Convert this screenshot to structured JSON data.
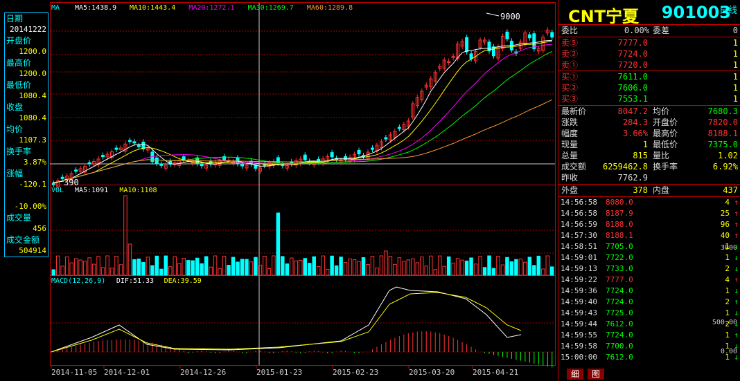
{
  "left": {
    "period": "日线",
    "fields": [
      {
        "label": "日期",
        "value": "20141222",
        "color": "#ffffff"
      },
      {
        "label": "开盘价",
        "value": "1200.0",
        "color": "#ffff00"
      },
      {
        "label": "最高价",
        "value": "1200.0",
        "color": "#ffff00"
      },
      {
        "label": "最低价",
        "value": "1080.4",
        "color": "#ffff00"
      },
      {
        "label": "收盘",
        "value": "1080.4",
        "color": "#ffff00"
      },
      {
        "label": "均价",
        "value": "1107.3",
        "color": "#ffff00"
      },
      {
        "label": "换手率",
        "value": "3.87%",
        "color": "#ffff00"
      },
      {
        "label": "涨幅",
        "value": "-120.1",
        "color": "#ffff00"
      },
      {
        "label": "",
        "value": "-10.00%",
        "color": "#ffff00"
      },
      {
        "label": "成交量",
        "value": "456",
        "color": "#ffff00"
      },
      {
        "label": "成交金额",
        "value": "504914",
        "color": "#ffff00"
      }
    ],
    "axis": {
      "vol1": "3000",
      "macd1": "500.00",
      "macd0": "0.00"
    }
  },
  "chart": {
    "ma_legend": [
      {
        "label": "MA",
        "color": "#00ffff"
      },
      {
        "label": "MA5:1438.9",
        "color": "#ffffff"
      },
      {
        "label": "MA10:1443.4",
        "color": "#ffff00"
      },
      {
        "label": "MA20:1272.1",
        "color": "#ff00ff"
      },
      {
        "label": "MA30:1269.7",
        "color": "#00ff00"
      },
      {
        "label": "MA60:1289.8",
        "color": "#ff9933"
      }
    ],
    "vol_legend": [
      {
        "label": "VOL",
        "color": "#00ffff"
      },
      {
        "label": "MA5:1091",
        "color": "#ffffff"
      },
      {
        "label": "MA10:1108",
        "color": "#ffff00"
      }
    ],
    "macd_legend": [
      {
        "label": "MACD(12,26,9)",
        "color": "#00ffff"
      },
      {
        "label": "DIF:51.33",
        "color": "#ffffff"
      },
      {
        "label": "DEA:39.59",
        "color": "#ffff00"
      }
    ],
    "hi_label": "9000",
    "lo_label": "390",
    "dates": [
      "2014-11-05",
      "2014-12-01",
      "2014-12-26",
      "2015-01-23",
      "2015-02-23",
      "2015-03-20",
      "2015-04-21"
    ]
  },
  "chart_data": {
    "type": "line",
    "title": "",
    "note": "Candlestick price chart with volume and MACD sub-panels; values approximate.",
    "x_ticks": [
      "2014-11-05",
      "2014-12-01",
      "2014-12-26",
      "2015-01-23",
      "2015-02-23",
      "2015-03-20",
      "2015-04-21"
    ],
    "price_annotations": {
      "high": 9000,
      "low": 390
    },
    "macd_axis": [
      0,
      500
    ],
    "vol_axis_max": 3000,
    "series": [
      {
        "name": "MA5",
        "values": [
          1438.9
        ]
      },
      {
        "name": "MA10",
        "values": [
          1443.4
        ]
      },
      {
        "name": "MA20",
        "values": [
          1272.1
        ]
      },
      {
        "name": "MA30",
        "values": [
          1269.7
        ]
      },
      {
        "name": "MA60",
        "values": [
          1289.8
        ]
      }
    ]
  },
  "panel": {
    "name": "CNT宁夏",
    "code": "901003",
    "weibi": {
      "l1": "委比",
      "v1": "0.00%",
      "l2": "委差",
      "v2": "0"
    },
    "sells": [
      {
        "label": "卖⑤",
        "price": "7777.0",
        "qty": "1"
      },
      {
        "label": "卖②",
        "price": "7724.0",
        "qty": "1"
      },
      {
        "label": "卖①",
        "price": "7720.0",
        "qty": "1"
      }
    ],
    "buys": [
      {
        "label": "买①",
        "price": "7611.0",
        "qty": "1"
      },
      {
        "label": "买②",
        "price": "7606.0",
        "qty": "1"
      },
      {
        "label": "买③",
        "price": "7553.1",
        "qty": "1"
      }
    ],
    "stats": [
      {
        "l1": "最新价",
        "v1": "8047.2",
        "c1": "#ff3333",
        "l2": "均价",
        "v2": "7680.3",
        "c2": "#00ff00"
      },
      {
        "l1": "涨跌",
        "v1": "284.3",
        "c1": "#ff3333",
        "l2": "开盘价",
        "v2": "7820.0",
        "c2": "#ff3333"
      },
      {
        "l1": "幅度",
        "v1": "3.66%",
        "c1": "#ff3333",
        "l2": "最高价",
        "v2": "8188.1",
        "c2": "#ff3333"
      },
      {
        "l1": "现量",
        "v1": "1",
        "c1": "#ffff00",
        "l2": "最低价",
        "v2": "7375.0",
        "c2": "#00ff00"
      },
      {
        "l1": "总量",
        "v1": "815",
        "c1": "#ffff00",
        "l2": "量比",
        "v2": "1.02",
        "c2": "#ffff00"
      },
      {
        "l1": "成交额",
        "v1": "6259462.8",
        "c1": "#ffff00",
        "l2": "换手率",
        "v2": "6.92%",
        "c2": "#ffff00"
      },
      {
        "l1": "昨收",
        "v1": "7762.9",
        "c1": "#dddddd",
        "l2": "",
        "v2": "",
        "c2": "#dddddd"
      }
    ],
    "outer": {
      "l1": "外盘",
      "v1": "378",
      "l2": "内盘",
      "v2": "437"
    },
    "ticks": [
      {
        "time": "14:56:58",
        "price": "8080.0",
        "qty": "4",
        "dir": "↑",
        "color": "#ff3333"
      },
      {
        "time": "14:56:58",
        "price": "8187.9",
        "qty": "25",
        "dir": "↑",
        "color": "#ff3333"
      },
      {
        "time": "14:56:59",
        "price": "8188.0",
        "qty": "96",
        "dir": "↑",
        "color": "#ff3333"
      },
      {
        "time": "14:57:30",
        "price": "8188.1",
        "qty": "40",
        "dir": "↑",
        "color": "#ff3333"
      },
      {
        "time": "14:58:51",
        "price": "7705.0",
        "qty": "1",
        "dir": "↓",
        "color": "#00ff00"
      },
      {
        "time": "14:59:01",
        "price": "7722.0",
        "qty": "1",
        "dir": "↓",
        "color": "#00ff00"
      },
      {
        "time": "14:59:13",
        "price": "7733.0",
        "qty": "2",
        "dir": "↓",
        "color": "#00ff00"
      },
      {
        "time": "14:59:22",
        "price": "7777.0",
        "qty": "4",
        "dir": "↑",
        "color": "#ff3333"
      },
      {
        "time": "14:59:36",
        "price": "7724.0",
        "qty": "1",
        "dir": "↓",
        "color": "#00ff00"
      },
      {
        "time": "14:59:40",
        "price": "7724.0",
        "qty": "2",
        "dir": "↑",
        "color": "#00ff00"
      },
      {
        "time": "14:59:43",
        "price": "7725.0",
        "qty": "1",
        "dir": "↓",
        "color": "#00ff00"
      },
      {
        "time": "14:59:44",
        "price": "7612.0",
        "qty": "2",
        "dir": "↓",
        "color": "#00ff00"
      },
      {
        "time": "14:59:55",
        "price": "7724.0",
        "qty": "1",
        "dir": "↑",
        "color": "#00ff00"
      },
      {
        "time": "14:59:58",
        "price": "7700.0",
        "qty": "1",
        "dir": "↓",
        "color": "#00ff00"
      },
      {
        "time": "15:00:00",
        "price": "7612.0",
        "qty": "1",
        "dir": "↓",
        "color": "#00ff00"
      }
    ],
    "tabs": [
      "细",
      "图"
    ]
  }
}
